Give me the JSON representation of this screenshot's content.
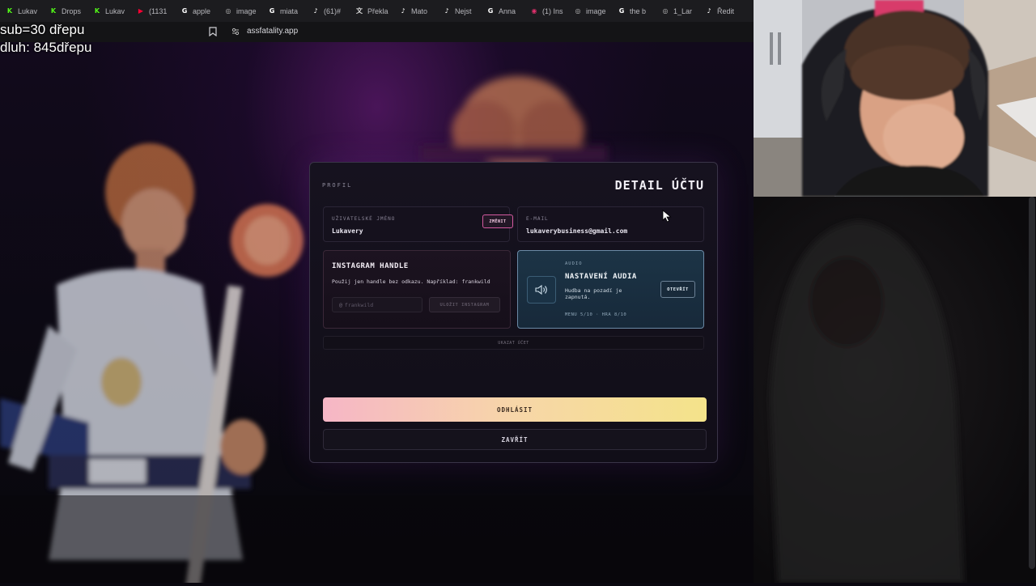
{
  "browser": {
    "tabs": [
      {
        "label": "Lukav",
        "icon": "k-green-icon",
        "color": "#53fc18"
      },
      {
        "label": "Drops",
        "icon": "k-green-icon",
        "color": "#53fc18"
      },
      {
        "label": "Lukav",
        "icon": "k-green-icon",
        "color": "#53fc18"
      },
      {
        "label": "(1131",
        "icon": "youtube-icon",
        "color": "#ff0033"
      },
      {
        "label": "apple",
        "icon": "google-icon",
        "color": "#ffffff"
      },
      {
        "label": "image",
        "icon": "globe-icon",
        "color": "#bbbbbb"
      },
      {
        "label": "miata",
        "icon": "google-icon",
        "color": "#ffffff"
      },
      {
        "label": "(61)#",
        "icon": "tiktok-icon",
        "color": "#ffffff"
      },
      {
        "label": "Překla",
        "icon": "translate-icon",
        "color": "#dddddd"
      },
      {
        "label": "Mato",
        "icon": "tiktok-icon",
        "color": "#ffffff"
      },
      {
        "label": "Nejst",
        "icon": "tiktok-icon",
        "color": "#ffffff"
      },
      {
        "label": "Anna",
        "icon": "google-icon",
        "color": "#ffffff"
      },
      {
        "label": "(1) Ins",
        "icon": "instagram-icon",
        "color": "#e1306c"
      },
      {
        "label": "image",
        "icon": "globe-icon",
        "color": "#bbbbbb"
      },
      {
        "label": "the b",
        "icon": "google-icon",
        "color": "#ffffff"
      },
      {
        "label": "1_Lar",
        "icon": "globe-icon",
        "color": "#bbbbbb"
      },
      {
        "label": "Ředit",
        "icon": "tiktok-icon",
        "color": "#ffffff"
      }
    ],
    "url": "assfatality.app"
  },
  "overlay": {
    "line1": "sub=30 dřepu",
    "line2": "dluh: 845dřepu"
  },
  "modal": {
    "eyebrow": "PROFIL",
    "title": "DETAIL ÚČTU",
    "username": {
      "label": "UŽIVATELSKÉ JMÉNO",
      "value": "Lukavery",
      "change_label": "ZMĚNIT"
    },
    "email": {
      "label": "E-MAIL",
      "value": "lukaverybusiness@gmail.com"
    },
    "instagram": {
      "title": "INSTAGRAM HANDLE",
      "hint": "Použij jen handle bez odkazu. Například: frankwild",
      "prefix": "@",
      "placeholder": "frankwild",
      "save_label": "ULOŽIT INSTAGRAM"
    },
    "audio": {
      "eyebrow": "AUDIO",
      "title": "NASTAVENÍ AUDIA",
      "description": "Hudba na pozadí je zapnutá.",
      "levels": "MENU 5/10 · HRA 8/10",
      "open_label": "OTEVŘÍT"
    },
    "show_account_label": "UKAZAT ÚČET",
    "logout_label": "ODHLÁSIT",
    "close_label": "ZAVŘÍT"
  },
  "colors": {
    "accent_pink": "#d45aa0",
    "audio_card": "#1c3446",
    "logout_gradient_start": "#f6b6c6",
    "logout_gradient_end": "#f4e38a"
  }
}
